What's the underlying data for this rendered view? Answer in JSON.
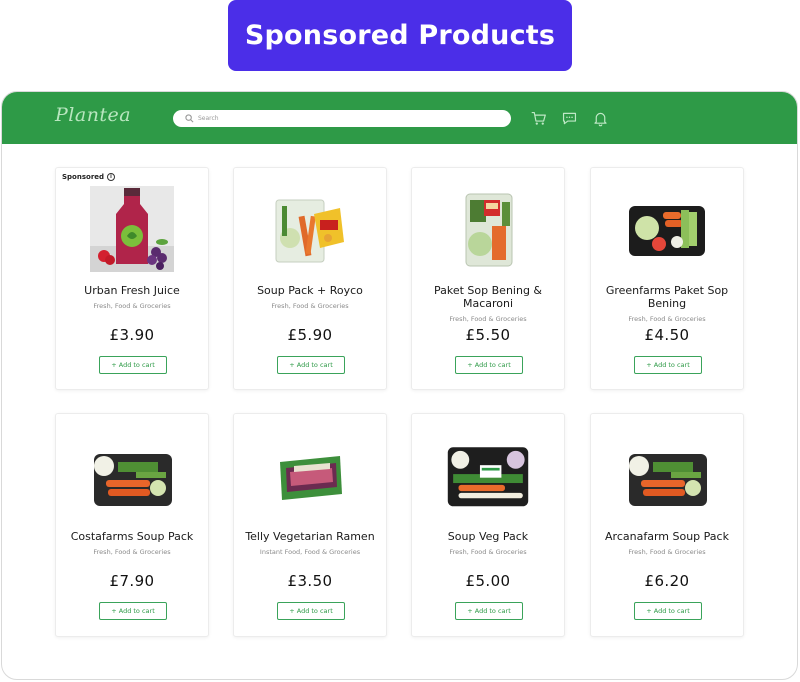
{
  "banner": {
    "title": "Sponsored Products",
    "color": "#4b2ee8"
  },
  "header": {
    "logo": "Plantea",
    "search_placeholder": "Search",
    "bar_color": "#2e9a47",
    "icons": [
      "cart-icon",
      "message-icon",
      "bell-icon"
    ]
  },
  "sponsored_label": "Sponsored",
  "add_to_cart_label": "+ Add to cart",
  "products": [
    {
      "name": "Urban Fresh Juice",
      "category": "Fresh, Food & Groceries",
      "price": "£3.90",
      "sponsored": true
    },
    {
      "name": "Soup Pack + Royco",
      "category": "Fresh, Food & Groceries",
      "price": "£5.90"
    },
    {
      "name": "Paket Sop Bening & Macaroni",
      "category": "Fresh, Food & Groceries",
      "price": "£5.50"
    },
    {
      "name": "Greenfarms Paket Sop Bening",
      "category": "Fresh, Food & Groceries",
      "price": "£4.50"
    },
    {
      "name": "Costafarms Soup Pack",
      "category": "Fresh, Food & Groceries",
      "price": "£7.90"
    },
    {
      "name": "Telly Vegetarian Ramen",
      "category": "Instant Food, Food & Groceries",
      "price": "£3.50"
    },
    {
      "name": "Soup Veg Pack",
      "category": "Fresh, Food & Groceries",
      "price": "£5.00"
    },
    {
      "name": "Arcanafarm Soup Pack",
      "category": "Fresh, Food & Groceries",
      "price": "£6.20"
    }
  ]
}
